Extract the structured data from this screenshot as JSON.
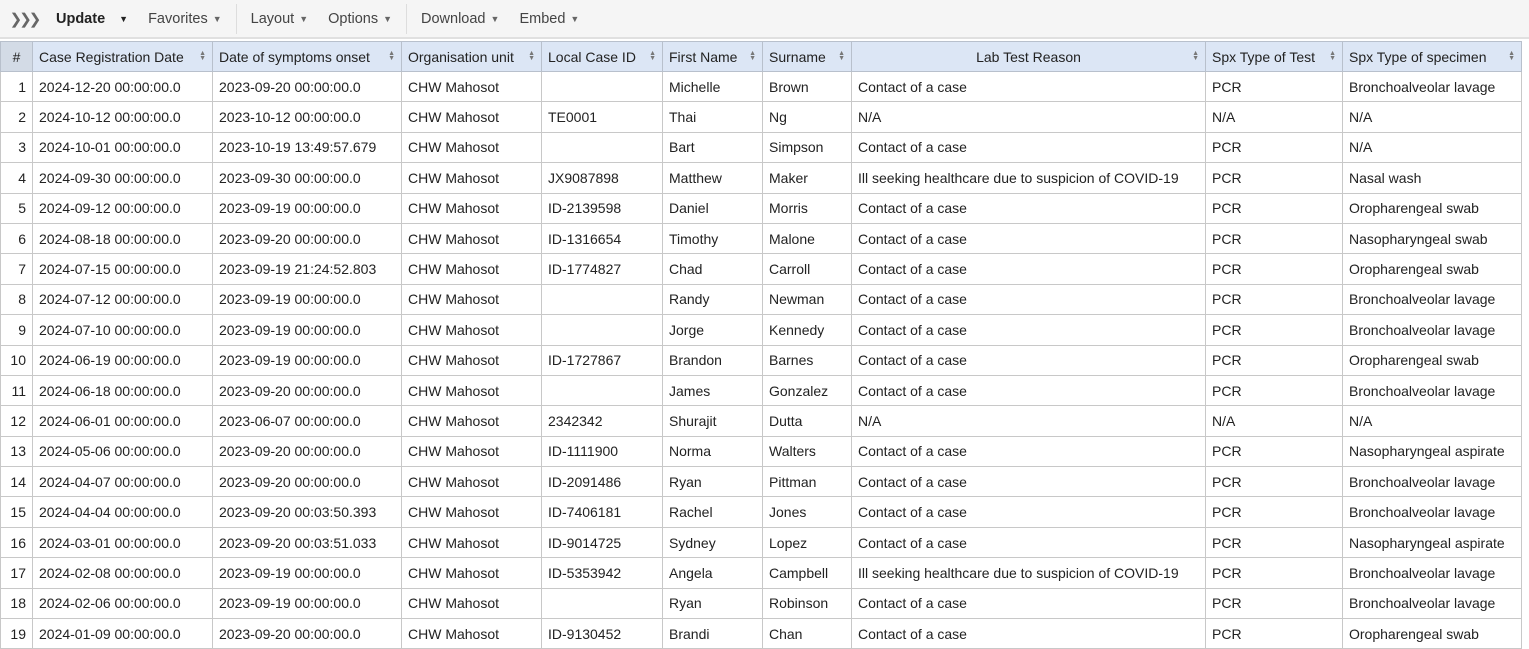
{
  "toolbar": {
    "update": "Update",
    "favorites": "Favorites",
    "layout": "Layout",
    "options": "Options",
    "download": "Download",
    "embed": "Embed"
  },
  "table": {
    "columns": [
      "#",
      "Case Registration Date",
      "Date of symptoms onset",
      "Organisation unit",
      "Local Case ID",
      "First Name",
      "Surname",
      "Lab Test Reason",
      "Spx Type of Test",
      "Spx Type of specimen"
    ],
    "rows": [
      [
        "1",
        "2024-12-20 00:00:00.0",
        "2023-09-20 00:00:00.0",
        "CHW Mahosot",
        "",
        "Michelle",
        "Brown",
        "Contact of a case",
        "PCR",
        "Bronchoalveolar lavage"
      ],
      [
        "2",
        "2024-10-12 00:00:00.0",
        "2023-10-12 00:00:00.0",
        "CHW Mahosot",
        "TE0001",
        "Thai",
        "Ng",
        "N/A",
        "N/A",
        "N/A"
      ],
      [
        "3",
        "2024-10-01 00:00:00.0",
        "2023-10-19 13:49:57.679",
        "CHW Mahosot",
        "",
        "Bart",
        "Simpson",
        "Contact of a case",
        "PCR",
        "N/A"
      ],
      [
        "4",
        "2024-09-30 00:00:00.0",
        "2023-09-30 00:00:00.0",
        "CHW Mahosot",
        "JX9087898",
        "Matthew",
        "Maker",
        "Ill seeking healthcare due to suspicion of COVID-19",
        "PCR",
        "Nasal wash"
      ],
      [
        "5",
        "2024-09-12 00:00:00.0",
        "2023-09-19 00:00:00.0",
        "CHW Mahosot",
        "ID-2139598",
        "Daniel",
        "Morris",
        "Contact of a case",
        "PCR",
        "Oropharengeal swab"
      ],
      [
        "6",
        "2024-08-18 00:00:00.0",
        "2023-09-20 00:00:00.0",
        "CHW Mahosot",
        "ID-1316654",
        "Timothy",
        "Malone",
        "Contact of a case",
        "PCR",
        "Nasopharyngeal swab"
      ],
      [
        "7",
        "2024-07-15 00:00:00.0",
        "2023-09-19 21:24:52.803",
        "CHW Mahosot",
        "ID-1774827",
        "Chad",
        "Carroll",
        "Contact of a case",
        "PCR",
        "Oropharengeal swab"
      ],
      [
        "8",
        "2024-07-12 00:00:00.0",
        "2023-09-19 00:00:00.0",
        "CHW Mahosot",
        "",
        "Randy",
        "Newman",
        "Contact of a case",
        "PCR",
        "Bronchoalveolar lavage"
      ],
      [
        "9",
        "2024-07-10 00:00:00.0",
        "2023-09-19 00:00:00.0",
        "CHW Mahosot",
        "",
        "Jorge",
        "Kennedy",
        "Contact of a case",
        "PCR",
        "Bronchoalveolar lavage"
      ],
      [
        "10",
        "2024-06-19 00:00:00.0",
        "2023-09-19 00:00:00.0",
        "CHW Mahosot",
        "ID-1727867",
        "Brandon",
        "Barnes",
        "Contact of a case",
        "PCR",
        "Oropharengeal swab"
      ],
      [
        "11",
        "2024-06-18 00:00:00.0",
        "2023-09-20 00:00:00.0",
        "CHW Mahosot",
        "",
        "James",
        "Gonzalez",
        "Contact of a case",
        "PCR",
        "Bronchoalveolar lavage"
      ],
      [
        "12",
        "2024-06-01 00:00:00.0",
        "2023-06-07 00:00:00.0",
        "CHW Mahosot",
        "2342342",
        "Shurajit",
        "Dutta",
        "N/A",
        "N/A",
        "N/A"
      ],
      [
        "13",
        "2024-05-06 00:00:00.0",
        "2023-09-20 00:00:00.0",
        "CHW Mahosot",
        "ID-1111900",
        "Norma",
        "Walters",
        "Contact of a case",
        "PCR",
        "Nasopharyngeal aspirate"
      ],
      [
        "14",
        "2024-04-07 00:00:00.0",
        "2023-09-20 00:00:00.0",
        "CHW Mahosot",
        "ID-2091486",
        "Ryan",
        "Pittman",
        "Contact of a case",
        "PCR",
        "Bronchoalveolar lavage"
      ],
      [
        "15",
        "2024-04-04 00:00:00.0",
        "2023-09-20 00:03:50.393",
        "CHW Mahosot",
        "ID-7406181",
        "Rachel",
        "Jones",
        "Contact of a case",
        "PCR",
        "Bronchoalveolar lavage"
      ],
      [
        "16",
        "2024-03-01 00:00:00.0",
        "2023-09-20 00:03:51.033",
        "CHW Mahosot",
        "ID-9014725",
        "Sydney",
        "Lopez",
        "Contact of a case",
        "PCR",
        "Nasopharyngeal aspirate"
      ],
      [
        "17",
        "2024-02-08 00:00:00.0",
        "2023-09-19 00:00:00.0",
        "CHW Mahosot",
        "ID-5353942",
        "Angela",
        "Campbell",
        "Ill seeking healthcare due to suspicion of COVID-19",
        "PCR",
        "Bronchoalveolar lavage"
      ],
      [
        "18",
        "2024-02-06 00:00:00.0",
        "2023-09-19 00:00:00.0",
        "CHW Mahosot",
        "",
        "Ryan",
        "Robinson",
        "Contact of a case",
        "PCR",
        "Bronchoalveolar lavage"
      ],
      [
        "19",
        "2024-01-09 00:00:00.0",
        "2023-09-20 00:00:00.0",
        "CHW Mahosot",
        "ID-9130452",
        "Brandi",
        "Chan",
        "Contact of a case",
        "PCR",
        "Oropharengeal swab"
      ]
    ]
  }
}
